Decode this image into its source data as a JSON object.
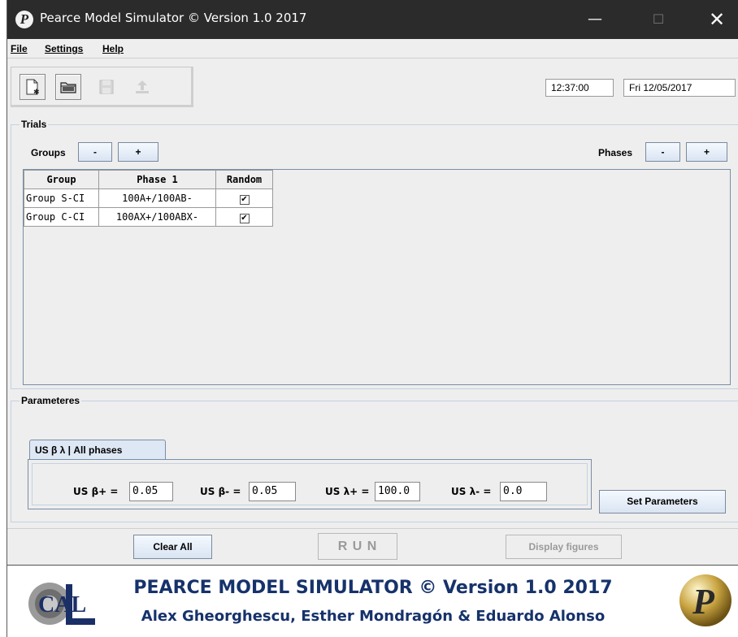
{
  "window": {
    "title": "Pearce Model Simulator © Version 1.0 2017",
    "app_icon_glyph": "P",
    "minimize_glyph": "—",
    "maximize_glyph": "☐",
    "close_glyph": "✕"
  },
  "menu": {
    "items": [
      "File",
      "Settings",
      "Help"
    ]
  },
  "toolbar": {
    "buttons": [
      {
        "icon": "new-file-icon",
        "enabled": true
      },
      {
        "icon": "open-folder-icon",
        "enabled": true
      },
      {
        "icon": "save-icon",
        "enabled": false
      },
      {
        "icon": "export-icon",
        "enabled": false
      }
    ],
    "time": "12:37:00",
    "date": "Fri 12/05/2017"
  },
  "trials": {
    "title": "Trials",
    "groups_label": "Groups",
    "phases_label": "Phases",
    "minus_label": "-",
    "plus_label": "+",
    "columns": [
      "Group",
      "Phase 1",
      "Random"
    ],
    "rows": [
      {
        "group": "Group S-CI",
        "phase1": "100A+/100AB-",
        "random": true
      },
      {
        "group": "Group C-CI",
        "phase1": "100AX+/100ABX-",
        "random": true
      }
    ],
    "check_glyph": "✔"
  },
  "parameters": {
    "title": "Parameteres",
    "tab_label": "US β λ | All phases",
    "beta_plus_label": "US β+ =",
    "beta_plus_value": "0.05",
    "beta_minus_label": "US β- =",
    "beta_minus_value": "0.05",
    "lambda_plus_label": "US λ+ =",
    "lambda_plus_value": "100.0",
    "lambda_minus_label": "US λ- =",
    "lambda_minus_value": "0.0",
    "set_button": "Set Parameters"
  },
  "actions": {
    "clear_all": "Clear All",
    "run": "R U N",
    "display_figures": "Display figures"
  },
  "banner": {
    "line1": "PEARCE MODEL SIMULATOR © Version 1.0  2017",
    "line2": "Alex Gheorghescu, Esther Mondragón & Eduardo Alonso",
    "left_logo_text": "CAL",
    "right_logo_glyph": "P"
  },
  "colors": {
    "titlebar": "#2b2b2b",
    "banner_text": "#16326b",
    "button_gradient_top": "#f5f9ff",
    "button_gradient_bottom": "#d9e4f2"
  }
}
